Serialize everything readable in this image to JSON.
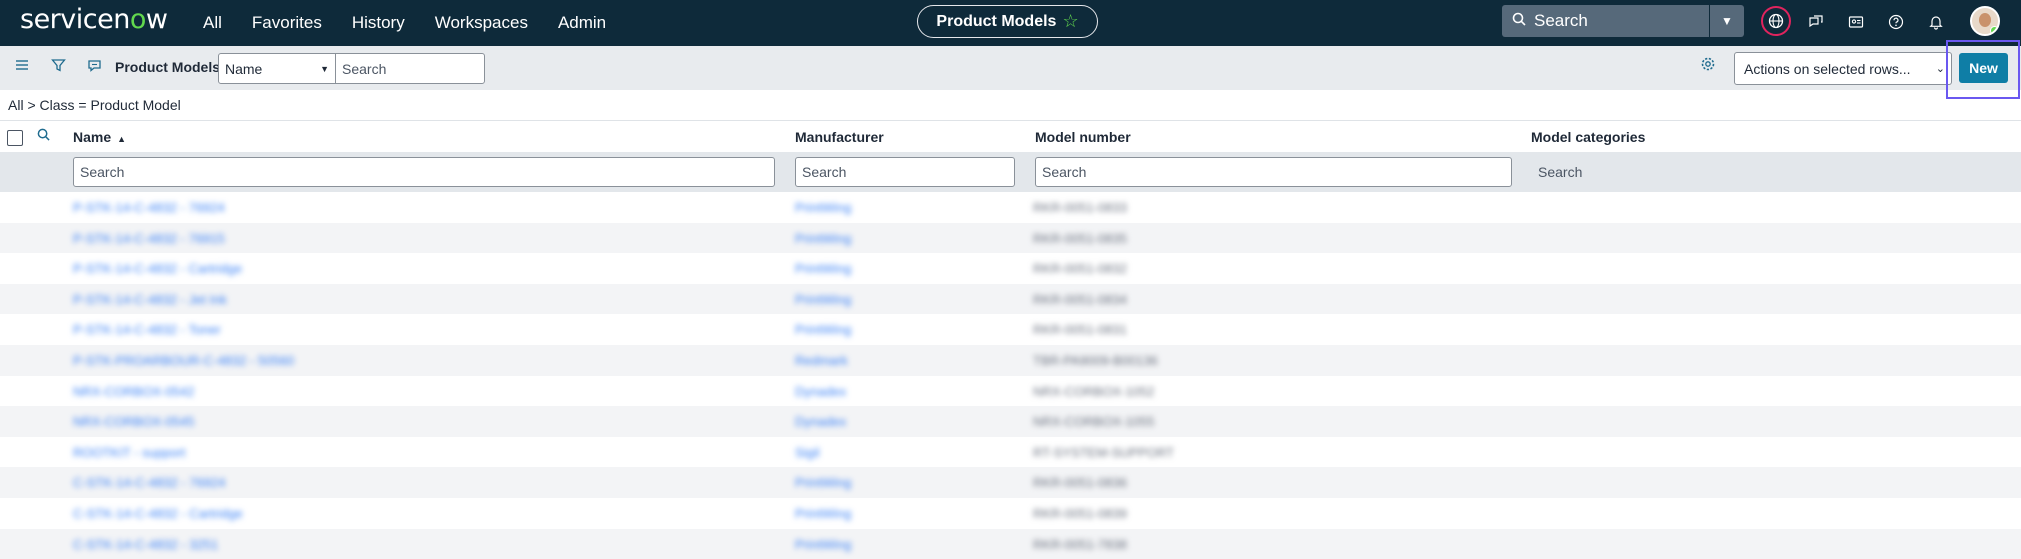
{
  "app": {
    "logo_prefix": "servicen",
    "logo_o": "o",
    "logo_suffix": "w",
    "menu": [
      "All",
      "Favorites",
      "History",
      "Workspaces",
      "Admin"
    ],
    "context_title": "Product Models",
    "search_placeholder": "Search",
    "icons": [
      "search-icon",
      "chevron-down-icon",
      "globe-icon",
      "chat-icon",
      "contact-card-icon",
      "help-icon",
      "bell-icon",
      "avatar"
    ]
  },
  "listbar": {
    "title": "Product Models",
    "field_select": "Name",
    "search_placeholder": "Search",
    "actions_label": "Actions on selected rows...",
    "new_label": "New"
  },
  "breadcrumb": "All > Class = Product Model",
  "columns": {
    "name": "Name",
    "manufacturer": "Manufacturer",
    "model_number": "Model number",
    "model_categories": "Model categories"
  },
  "filters": {
    "name": "Search",
    "manufacturer": "Search",
    "model_number": "Search",
    "model_categories": "Search"
  },
  "rows": [
    {
      "name": "P-STK-14-C-4832 - 76924",
      "manufacturer": "PrintWing",
      "model_number": "RKR-0051-0833"
    },
    {
      "name": "P-STK-14-C-4832 - 76915",
      "manufacturer": "PrintWing",
      "model_number": "RKR-0051-0835"
    },
    {
      "name": "P-STK-14-C-4832 - Cartridge",
      "manufacturer": "PrintWing",
      "model_number": "RKR-0051-0832"
    },
    {
      "name": "P-STK-14-C-4832 - Jet Ink",
      "manufacturer": "PrintWing",
      "model_number": "RKR-0051-0834"
    },
    {
      "name": "P-STK-14-C-4832 - Toner",
      "manufacturer": "PrintWing",
      "model_number": "RKR-0051-0831"
    },
    {
      "name": "P-STK-PROARBOUR-C-4832 - 50560",
      "manufacturer": "Redmark",
      "model_number": "TBR-PA9009-B00136"
    },
    {
      "name": "NRX-CORBOX-0542",
      "manufacturer": "Dynadex",
      "model_number": "NRX-CORBOX-1052"
    },
    {
      "name": "NRX-CORBOX-0545",
      "manufacturer": "Dynadex",
      "model_number": "NRX-CORBOX-1055"
    },
    {
      "name": "ROOTKIT - support",
      "manufacturer": "Sigil",
      "model_number": "RT-SYSTEM-SUPPORT"
    },
    {
      "name": "C-STK-14-C-4832 - 76924",
      "manufacturer": "PrintWing",
      "model_number": "RKR-0051-0836"
    },
    {
      "name": "C-STK-14-C-4832 - Cartridge",
      "manufacturer": "PrintWing",
      "model_number": "RKR-0051-0839"
    },
    {
      "name": "C-STK-14-C-4832 - 3251",
      "manufacturer": "PrintWing",
      "model_number": "RKR-0051-7838"
    }
  ]
}
